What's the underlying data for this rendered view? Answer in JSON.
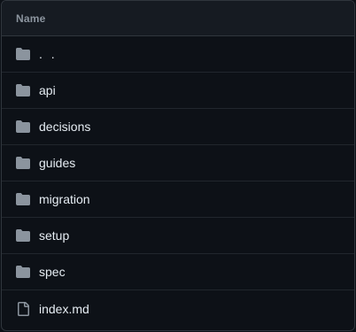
{
  "table": {
    "header": "Name",
    "items": [
      {
        "label": ". .",
        "kind": "folder",
        "icon": "folder-icon"
      },
      {
        "label": "api",
        "kind": "folder",
        "icon": "folder-icon"
      },
      {
        "label": "decisions",
        "kind": "folder",
        "icon": "folder-icon"
      },
      {
        "label": "guides",
        "kind": "folder",
        "icon": "folder-icon"
      },
      {
        "label": "migration",
        "kind": "folder",
        "icon": "folder-icon"
      },
      {
        "label": "setup",
        "kind": "folder",
        "icon": "folder-icon"
      },
      {
        "label": "spec",
        "kind": "folder",
        "icon": "folder-icon"
      },
      {
        "label": "index.md",
        "kind": "file",
        "icon": "file-icon"
      }
    ]
  },
  "colors": {
    "background": "#0d1117",
    "header_background": "#161b22",
    "border": "#30363d",
    "row_divider": "#21262d",
    "header_text": "#8b949e",
    "text": "#e6edf3",
    "icon": "#8b949e"
  }
}
